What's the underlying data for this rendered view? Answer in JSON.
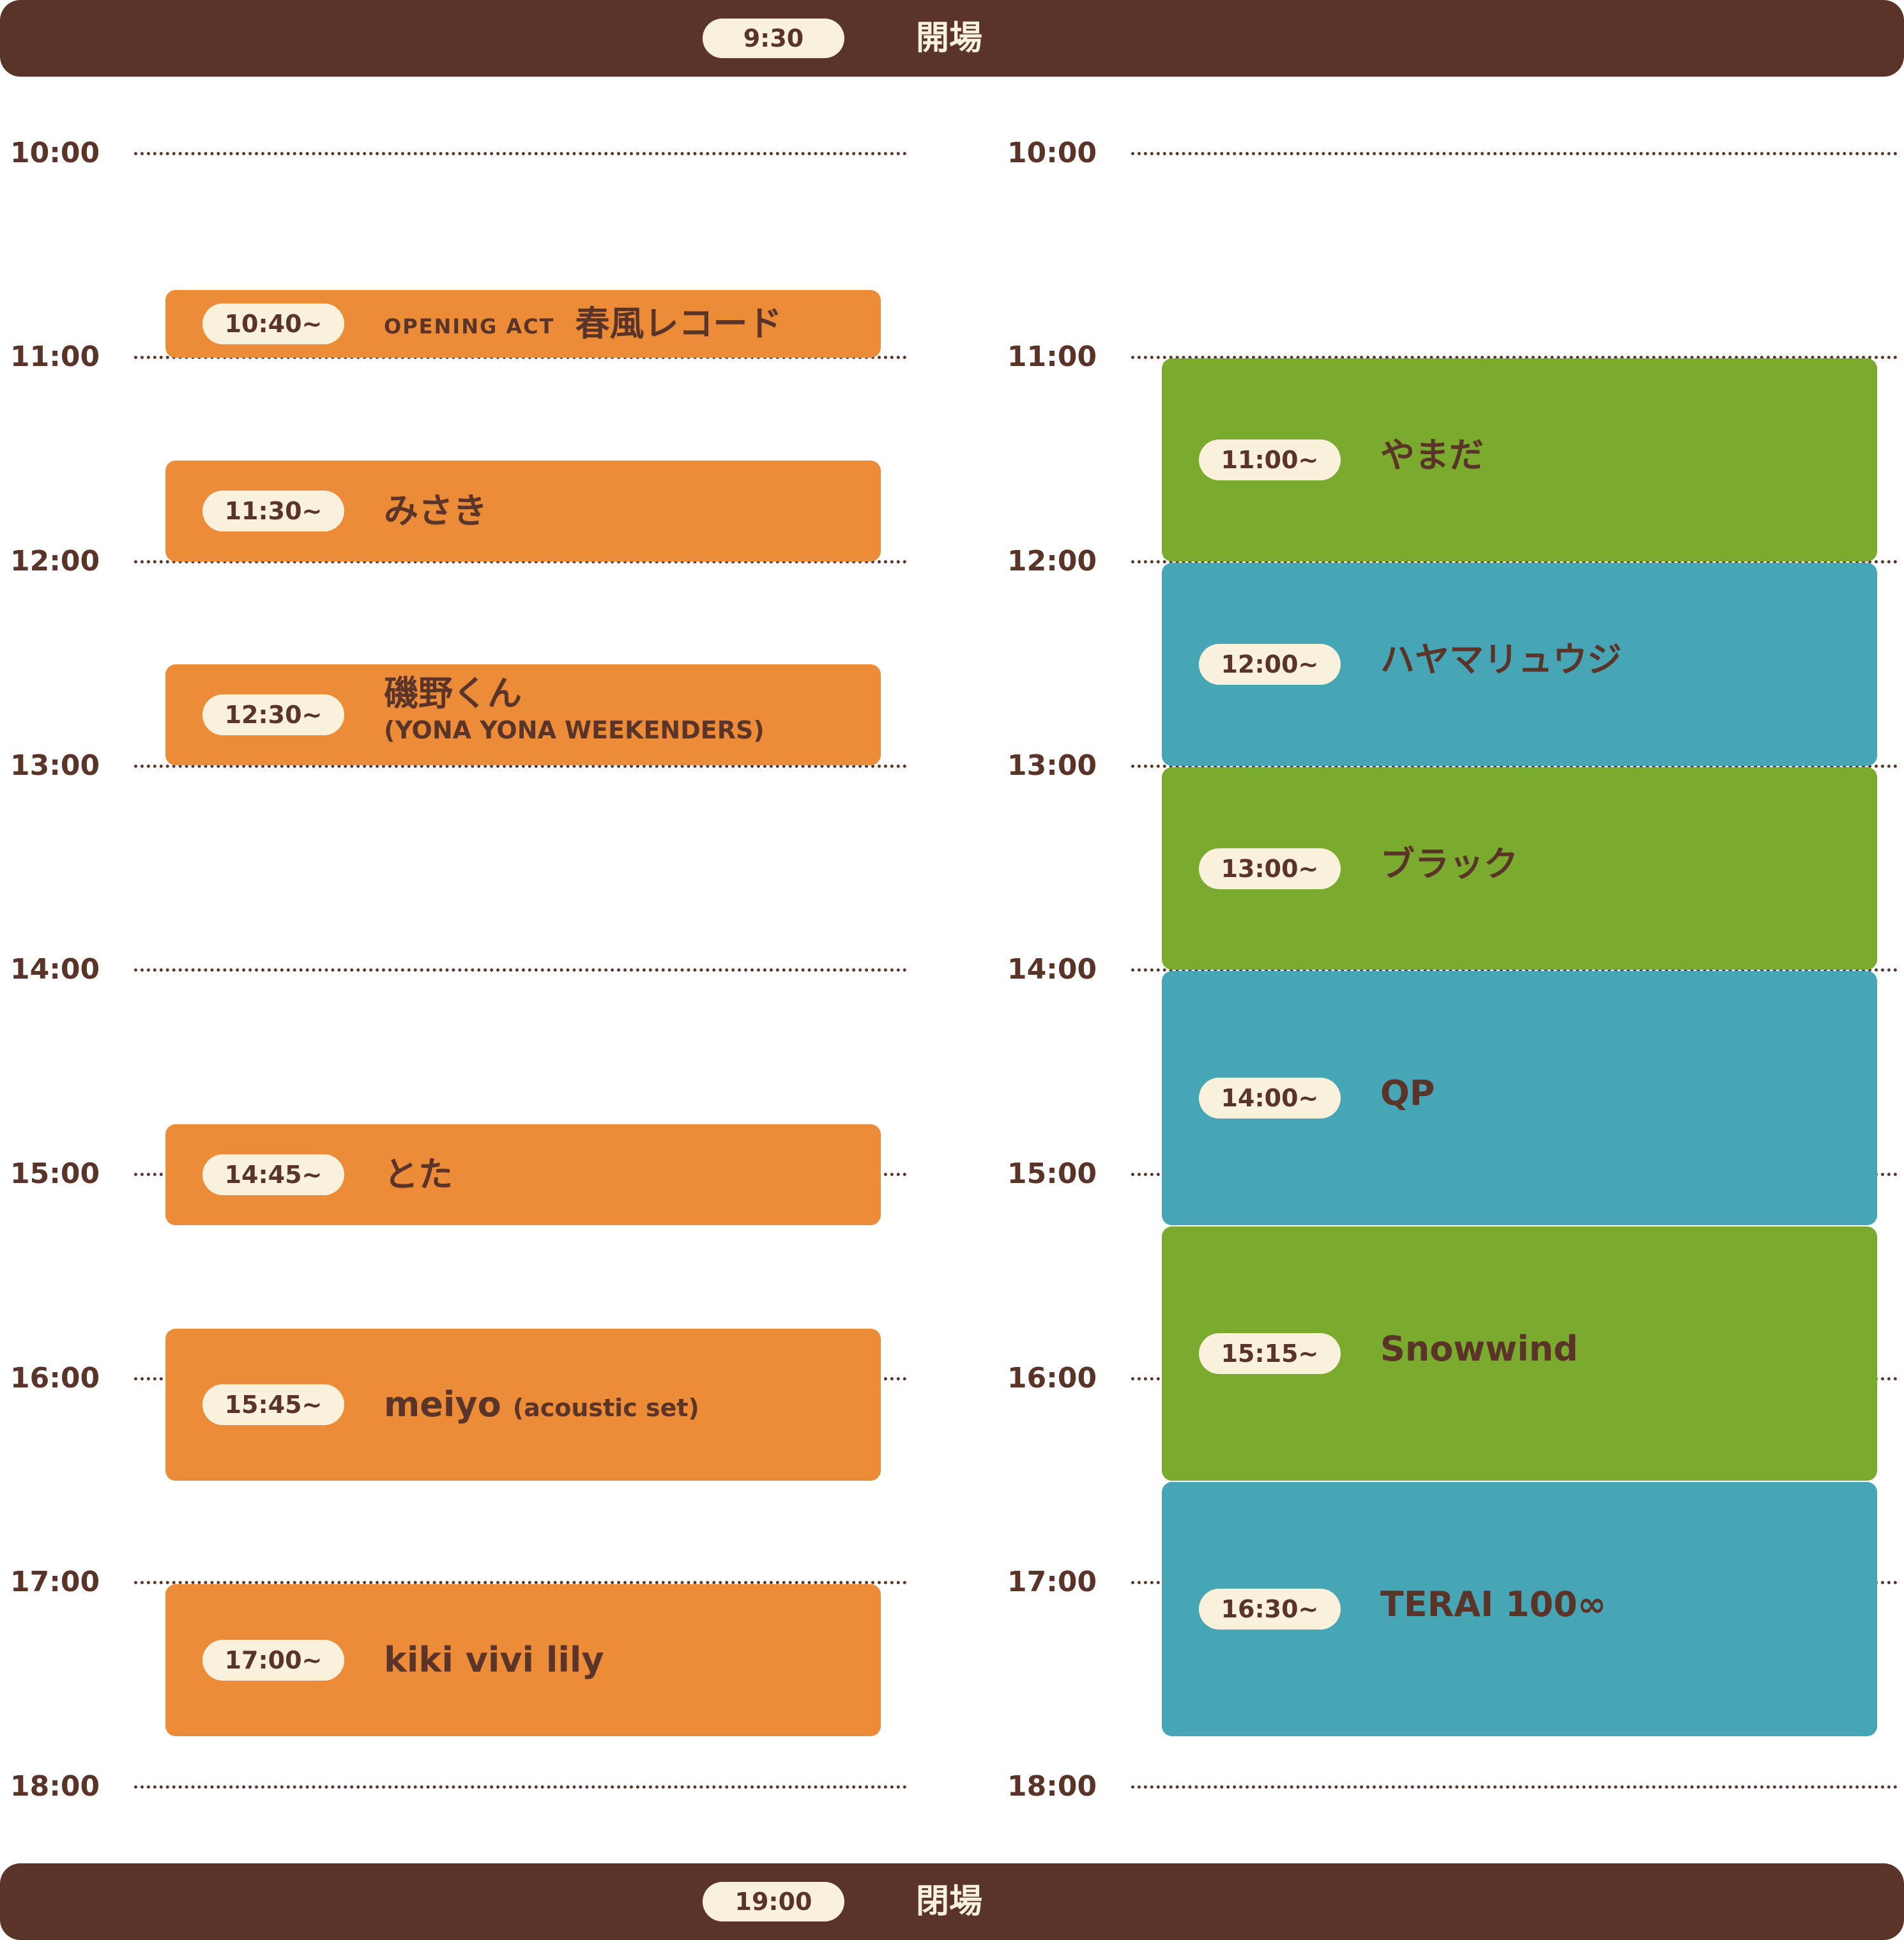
{
  "header": {
    "time": "9:30",
    "label": "開場"
  },
  "footer": {
    "time": "19:00",
    "label": "閉場"
  },
  "left_timeline": {
    "ticks": [
      "10:00",
      "11:00",
      "12:00",
      "13:00",
      "14:00",
      "15:00",
      "16:00",
      "17:00",
      "18:00"
    ],
    "slots": [
      {
        "time": "10:40~",
        "opening_label": "OPENING ACT",
        "name": "春風レコード",
        "start": "10:40",
        "end": "11:00",
        "color": "#ed8c38"
      },
      {
        "time": "11:30~",
        "name": "みさき",
        "start": "11:30",
        "end": "12:00",
        "color": "#ed8c38"
      },
      {
        "time": "12:30~",
        "name": "磯野くん",
        "sub": "(YONA YONA WEEKENDERS)",
        "start": "12:30",
        "end": "13:00",
        "color": "#ed8c38"
      },
      {
        "time": "14:45~",
        "name": "とた",
        "start": "14:45",
        "end": "15:15",
        "color": "#ed8c38"
      },
      {
        "time": "15:45~",
        "name": "meiyo",
        "note": "(acoustic set)",
        "start": "15:45",
        "end": "16:30",
        "color": "#ed8c38"
      },
      {
        "time": "17:00~",
        "name": "kiki vivi lily",
        "start": "17:00",
        "end": "17:45",
        "color": "#ed8c38"
      }
    ]
  },
  "right_timeline": {
    "ticks": [
      "10:00",
      "11:00",
      "12:00",
      "13:00",
      "14:00",
      "15:00",
      "16:00",
      "17:00",
      "18:00"
    ],
    "slots": [
      {
        "time": "11:00~",
        "name": "やまだ",
        "start": "11:00",
        "end": "12:00",
        "color": "#7aaa2e"
      },
      {
        "time": "12:00~",
        "name": "ハヤマリュウジ",
        "start": "12:00",
        "end": "13:00",
        "color": "#47a6b6"
      },
      {
        "time": "13:00~",
        "name": "ブラック",
        "start": "13:00",
        "end": "14:00",
        "color": "#7aaa2e"
      },
      {
        "time": "14:00~",
        "name": "QP",
        "start": "14:00",
        "end": "15:15",
        "color": "#47a6b6"
      },
      {
        "time": "15:15~",
        "name": "Snowwind",
        "start": "15:15",
        "end": "16:30",
        "color": "#7aaa2e"
      },
      {
        "time": "16:30~",
        "name": "TERAI 100∞",
        "start": "16:30",
        "end": "17:45",
        "color": "#47a6b6"
      }
    ]
  }
}
